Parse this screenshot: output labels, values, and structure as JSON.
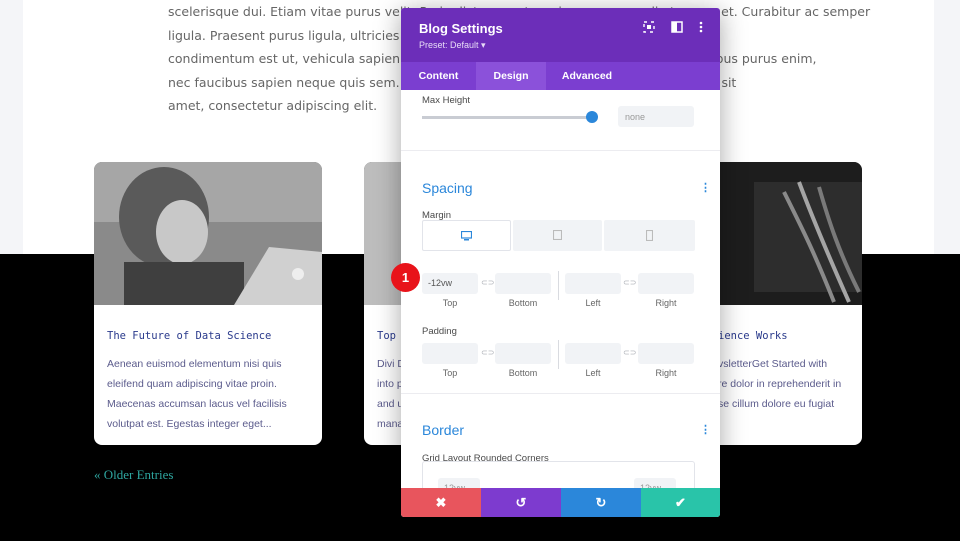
{
  "intro": {
    "lines": [
      "scelerisque dui. Etiam vitae purus velit. Proin dictum auctor mi, eu congue odio tempus et. Curabitur ac semper",
      "ligula. Praesent purus ligula, ultricies vel porta eu, viverra et mi.",
      "condimentum est ut, vehicula sapien. Donec ut arcu at nunc efficitur ultricies. Nulla finibus purus enim,",
      "nec faucibus sapien neque quis sem. Vivamus suscipit feugiat tortor, lorem ipsum dolor sit",
      "amet, consectetur adipiscing elit."
    ]
  },
  "cards": [
    {
      "title": "The Future of Data Science",
      "excerpt": [
        "Aenean euismod elementum nisi quis",
        "eleifend quam adipiscing vitae proin.",
        "Maecenas accumsan lacus vel facilisis",
        "volutpat est. Egestas integer eget..."
      ]
    },
    {
      "title": "Top",
      "excerpt": [
        "Divi D",
        "into p",
        "and u",
        "mana"
      ]
    },
    {
      "title": "ience Works",
      "excerpt": [
        "vsletterGet Started with",
        "re dolor in reprehenderit in",
        "se cillum dolore eu fugiat",
        ""
      ]
    }
  ],
  "older_entries": "« Older Entries",
  "modal": {
    "title": "Blog Settings",
    "preset": "Preset: Default ▾",
    "icons": [
      "expand-icon",
      "split-view-icon",
      "more-options-icon"
    ],
    "tabs": [
      {
        "label": "Content",
        "active": false
      },
      {
        "label": "Design",
        "active": true
      },
      {
        "label": "Advanced",
        "active": false
      }
    ],
    "max_height": {
      "label": "Max Height",
      "value": "none"
    },
    "spacing": {
      "title": "Spacing",
      "margin_label": "Margin",
      "devices": [
        "desktop-icon",
        "tablet-icon",
        "phone-icon"
      ],
      "margin": {
        "top": "-12vw",
        "bottom": "",
        "left": "",
        "right": ""
      },
      "padding_label": "Padding",
      "padding": {
        "top": "",
        "bottom": "",
        "left": "",
        "right": ""
      },
      "sublabels": [
        "Top",
        "Bottom",
        "Left",
        "Right"
      ],
      "link_glyph": "⊂⊃"
    },
    "border": {
      "title": "Border",
      "corners_label": "Grid Layout Rounded Corners",
      "corner_values": [
        "12vw",
        "12vw"
      ]
    },
    "footer": [
      {
        "name": "discard",
        "glyph": "✖",
        "color": "#e8555d"
      },
      {
        "name": "undo",
        "glyph": "↺",
        "color": "#7d3bcf"
      },
      {
        "name": "redo",
        "glyph": "↻",
        "color": "#2b87da"
      },
      {
        "name": "save",
        "glyph": "✔",
        "color": "#29c4a9"
      }
    ]
  },
  "annotation_badge": "1"
}
